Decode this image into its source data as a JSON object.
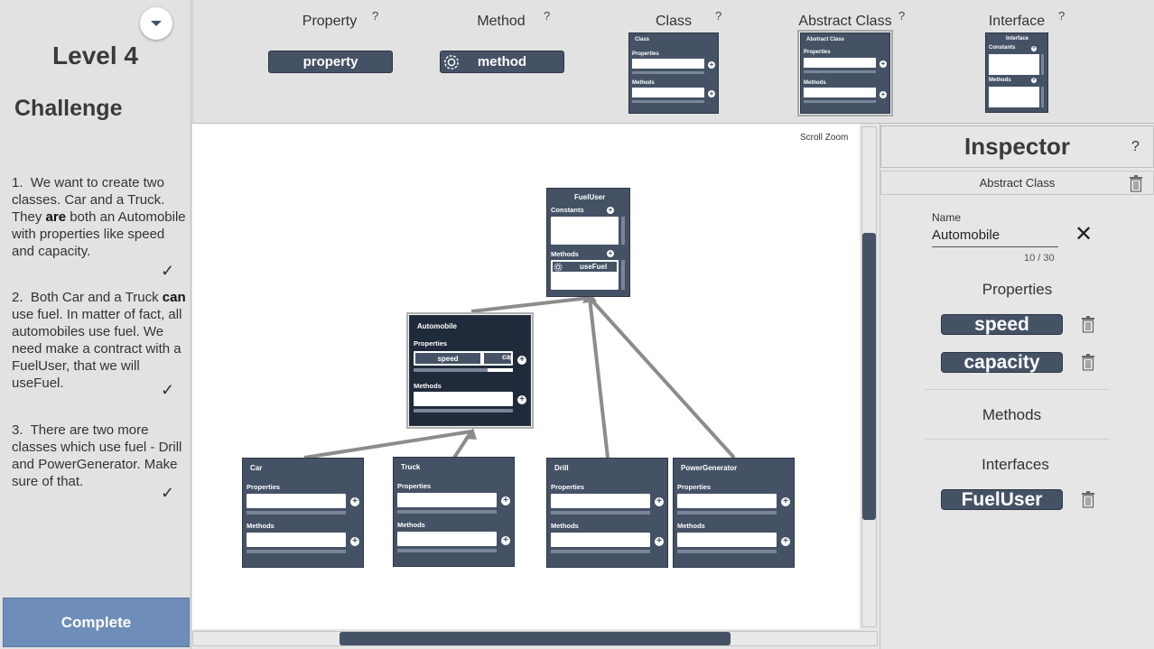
{
  "left_panel": {
    "level_title": "Level 4",
    "challenge_title": "Challenge",
    "tasks": [
      {
        "number": "1.",
        "text_before": "We want to create two classes. Car and a Truck. They ",
        "bold": "are",
        "text_after": " both an Automobile with properties like speed and capacity."
      },
      {
        "number": "2.",
        "text_before": "Both Car and a Truck ",
        "bold": "can",
        "text_after": " use fuel. In matter of fact, all automobiles use fuel. We need make a contract with a FuelUser, that we will useFuel."
      },
      {
        "number": "3.",
        "text_before": "There are two more classes which use fuel - Drill and PowerGenerator. Make sure of that.",
        "bold": "",
        "text_after": ""
      }
    ],
    "check_glyph": "✓",
    "complete_label": "Complete"
  },
  "toolbar": {
    "items": [
      {
        "label": "Property",
        "help": "?"
      },
      {
        "label": "Method",
        "help": "?"
      },
      {
        "label": "Class",
        "help": "?"
      },
      {
        "label": "Abstract Class",
        "help": "?"
      },
      {
        "label": "Interface",
        "help": "?"
      }
    ],
    "property_pill": "property",
    "method_pill": "method",
    "class_thumb": {
      "title": "Class",
      "sec1": "Properties",
      "sec2": "Methods"
    },
    "abstract_thumb": {
      "title": "Abstract Class",
      "sec1": "Properties",
      "sec2": "Methods"
    },
    "interface_thumb": {
      "title": "Interface",
      "sec1": "Constants",
      "sec2": "Methods"
    }
  },
  "canvas": {
    "scroll_zoom_label": "Scroll Zoom",
    "fueluser": {
      "title": "FuelUser",
      "sec1": "Constants",
      "sec2": "Methods",
      "method": "useFuel"
    },
    "automobile": {
      "title": "Automobile",
      "sec1": "Properties",
      "sec2": "Methods",
      "prop1": "speed",
      "prop2": "capacity"
    },
    "car": {
      "title": "Car",
      "sec1": "Properties",
      "sec2": "Methods"
    },
    "truck": {
      "title": "Truck",
      "sec1": "Properties",
      "sec2": "Methods"
    },
    "drill": {
      "title": "Drill",
      "sec1": "Properties",
      "sec2": "Methods"
    },
    "powergenerator": {
      "title": "PowerGenerator",
      "sec1": "Properties",
      "sec2": "Methods"
    }
  },
  "inspector": {
    "title": "Inspector",
    "help": "?",
    "subtitle": "Abstract Class",
    "name_label": "Name",
    "name_value": "Automobile",
    "char_count": "10 / 30",
    "properties_label": "Properties",
    "properties": [
      "speed",
      "capacity"
    ],
    "methods_label": "Methods",
    "interfaces_label": "Interfaces",
    "interfaces": [
      "FuelUser"
    ]
  },
  "colors": {
    "card": "#455266",
    "accent": "#6e8db8",
    "canvas": "#ffffff"
  }
}
